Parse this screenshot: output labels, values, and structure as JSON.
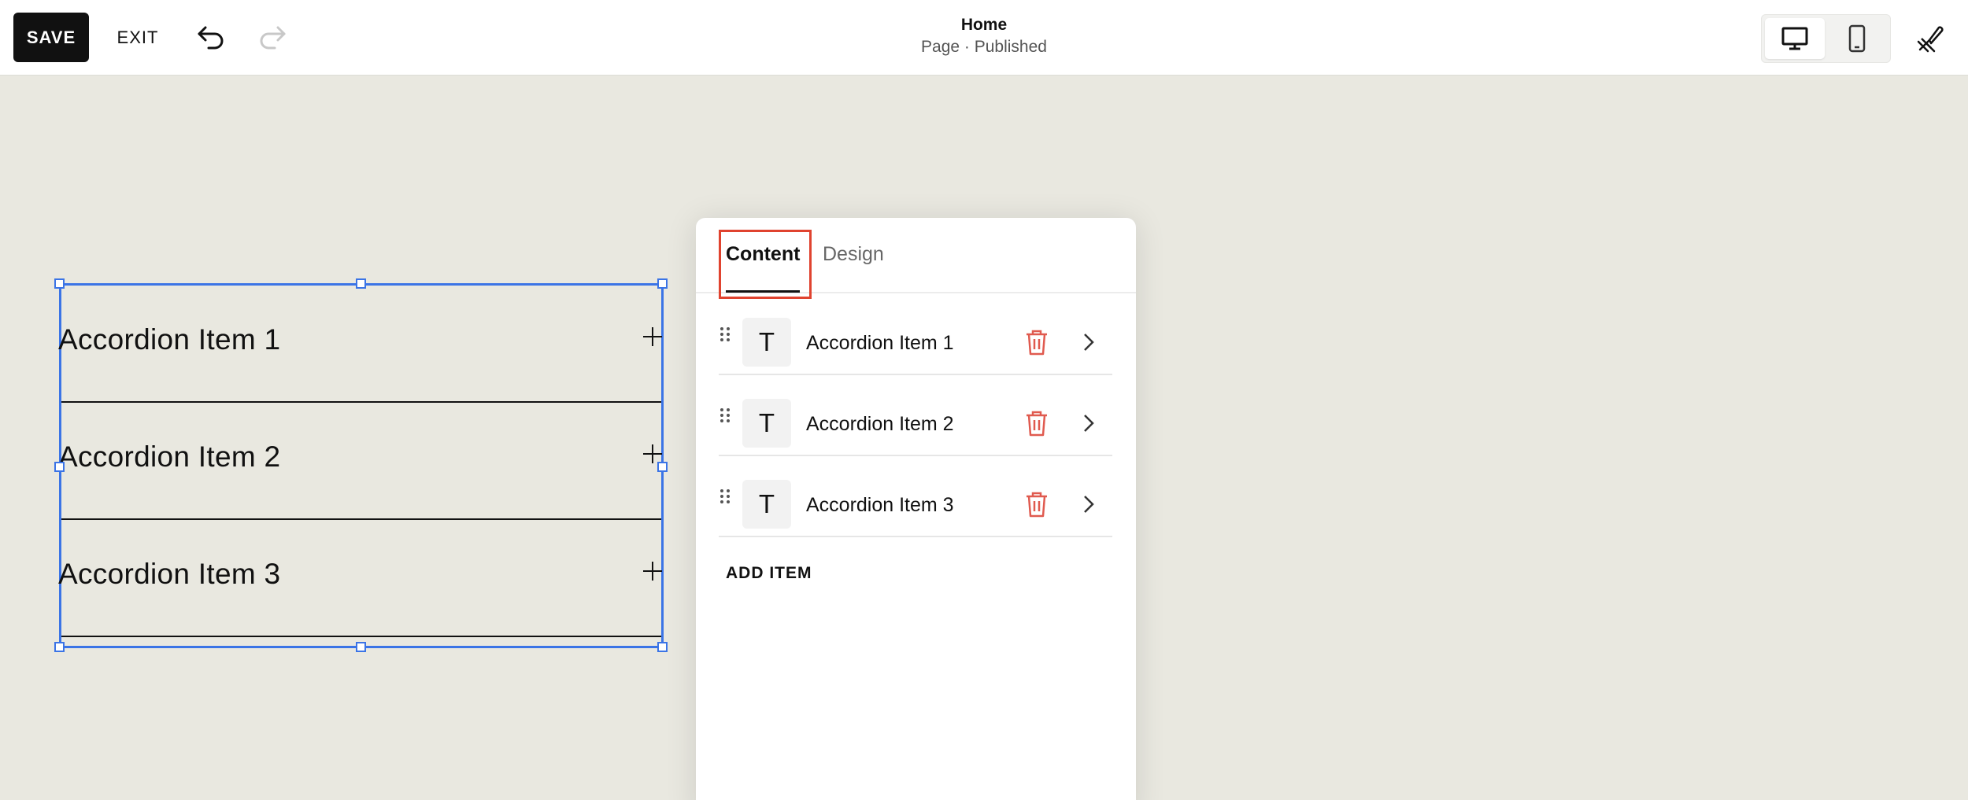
{
  "toolbar": {
    "save_label": "SAVE",
    "exit_label": "EXIT",
    "undo_icon": "undo-icon",
    "redo_icon": "redo-icon",
    "page_title": "Home",
    "page_status": "Page · Published",
    "device_views": [
      "desktop-icon",
      "mobile-icon"
    ],
    "active_device": "desktop",
    "style_icon": "paintbrush-icon"
  },
  "canvas": {
    "background": "#e9e8e0",
    "selection_color": "#3b74e6",
    "accordion_items": [
      {
        "title": "Accordion Item 1",
        "icon": "plus-icon"
      },
      {
        "title": "Accordion Item 2",
        "icon": "plus-icon"
      },
      {
        "title": "Accordion Item 3",
        "icon": "plus-icon"
      }
    ]
  },
  "panel": {
    "tabs": [
      {
        "label": "Content",
        "active": true
      },
      {
        "label": "Design",
        "active": false
      }
    ],
    "highlight_color": "#e0432f",
    "items": [
      {
        "type_glyph": "T",
        "label": "Accordion Item 1"
      },
      {
        "type_glyph": "T",
        "label": "Accordion Item 2"
      },
      {
        "type_glyph": "T",
        "label": "Accordion Item 3"
      }
    ],
    "delete_color": "#e05a4f",
    "add_item_label": "ADD ITEM"
  }
}
